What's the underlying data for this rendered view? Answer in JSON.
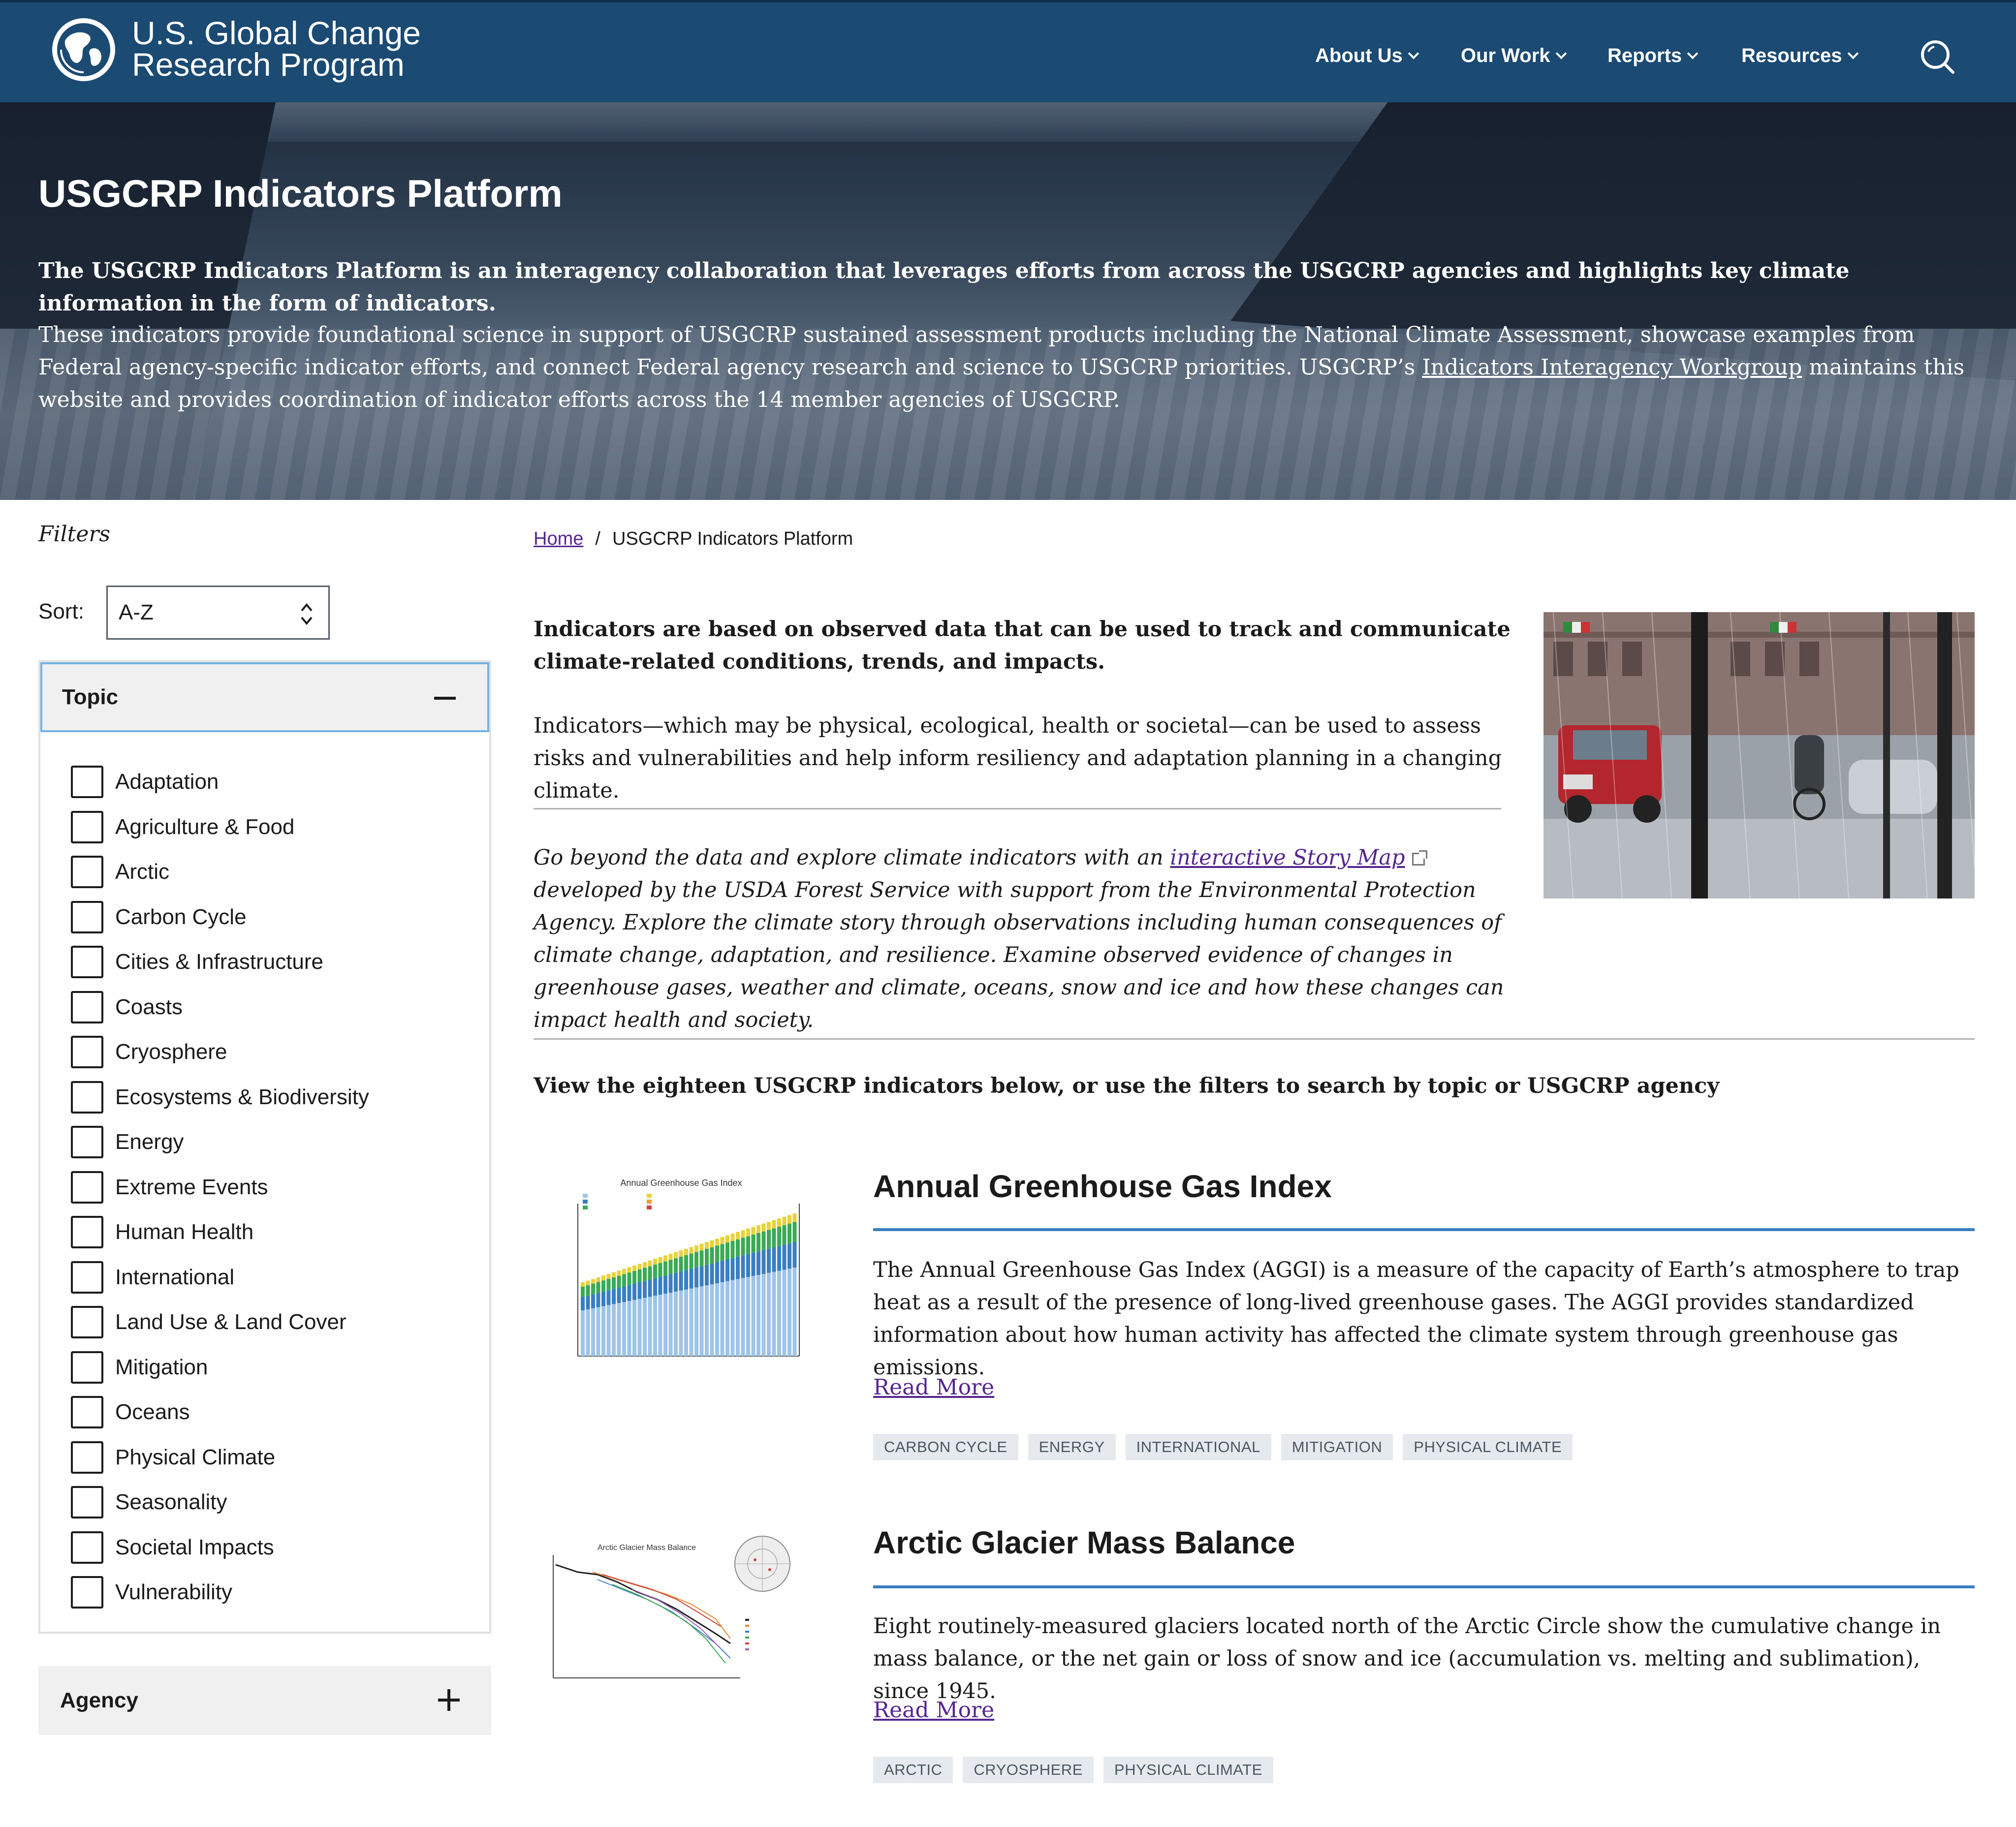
{
  "header": {
    "logo_line1": "U.S. Global Change",
    "logo_line2": "Research Program",
    "nav": [
      {
        "label": "About Us"
      },
      {
        "label": "Our Work"
      },
      {
        "label": "Reports"
      },
      {
        "label": "Resources"
      }
    ]
  },
  "hero": {
    "title": "USGCRP Indicators Platform",
    "lead": "The USGCRP Indicators Platform is an interagency collaboration that leverages efforts from across the USGCRP agencies and highlights key climate information in the form of indicators.",
    "body_before_link": "These indicators provide foundational science in support of USGCRP sustained assessment products including the National Climate Assessment, showcase examples from Federal agency-specific indicator efforts, and connect Federal agency research and science to USGCRP priorities. USGCRP’s ",
    "body_link": "Indicators Interagency Workgroup",
    "body_after_link": " maintains this website and provides coordination of indicator efforts across the 14 member agencies of USGCRP."
  },
  "filters": {
    "label": "Filters",
    "sort_label": "Sort:",
    "sort_value": "A-Z",
    "topic_label": "Topic",
    "topics": [
      "Adaptation",
      "Agriculture & Food",
      "Arctic",
      "Carbon Cycle",
      "Cities & Infrastructure",
      "Coasts",
      "Cryosphere",
      "Ecosystems & Biodiversity",
      "Energy",
      "Extreme Events",
      "Human Health",
      "International",
      "Land Use & Land Cover",
      "Mitigation",
      "Oceans",
      "Physical Climate",
      "Seasonality",
      "Societal Impacts",
      "Vulnerability"
    ],
    "agency_label": "Agency"
  },
  "breadcrumb": {
    "home": "Home",
    "separator": "/",
    "current": "USGCRP Indicators Platform"
  },
  "intro": {
    "bold": "Indicators are based on observed data that can be used to track and communicate climate-related conditions, trends, and impacts.",
    "body": "Indicators—which may be physical, ecological, health or societal—can be used to assess risks and vulnerabilities and help inform resiliency and adaptation planning in a changing climate.",
    "italic_before": "Go beyond the data and explore climate indicators with an ",
    "italic_link": "interactive Story Map",
    "italic_after": "developed by the USDA Forest Service with support from the Environmental Protection Agency. Explore the climate story through observations including human consequences of climate change, adaptation, and resilience. Examine observed evidence of changes in greenhouse gases, weather and climate, oceans, snow and ice and how these changes can impact health and society.",
    "view_all": "View the eighteen USGCRP indicators below, or use the filters to search by topic or USGCRP agency"
  },
  "cards": [
    {
      "title": "Annual Greenhouse Gas Index",
      "thumb_title": "Annual Greenhouse Gas Index",
      "description": "The Annual Greenhouse Gas Index (AGGI) is a measure of the capacity of Earth’s atmosphere to trap heat as a result of the presence of long-lived greenhouse gases. The AGGI provides standardized information about how human activity has affected the climate system through greenhouse gas emissions.",
      "read_more": "Read More",
      "tags": [
        "CARBON CYCLE",
        "ENERGY",
        "INTERNATIONAL",
        "MITIGATION",
        "PHYSICAL CLIMATE"
      ]
    },
    {
      "title": "Arctic Glacier Mass Balance",
      "thumb_title": "Arctic Glacier Mass Balance",
      "description": "Eight routinely-measured glaciers located north of the Arctic Circle show the cumulative change in mass balance, or the net gain or loss of snow and ice (accumulation vs. melting and sublimation), since 1945.",
      "read_more": "Read More",
      "tags": [
        "ARCTIC",
        "CRYOSPHERE",
        "PHYSICAL CLIMATE"
      ]
    }
  ],
  "colors": {
    "header_bg": "#1b4a73",
    "link": "#54278f",
    "accent_rule": "#3a7ec0",
    "tag_bg": "#e6eaee"
  },
  "icons": [
    "globe-logo-icon",
    "chevron-down-icon",
    "search-icon",
    "sort-arrows-icon",
    "minus-icon",
    "plus-icon",
    "external-link-icon"
  ]
}
